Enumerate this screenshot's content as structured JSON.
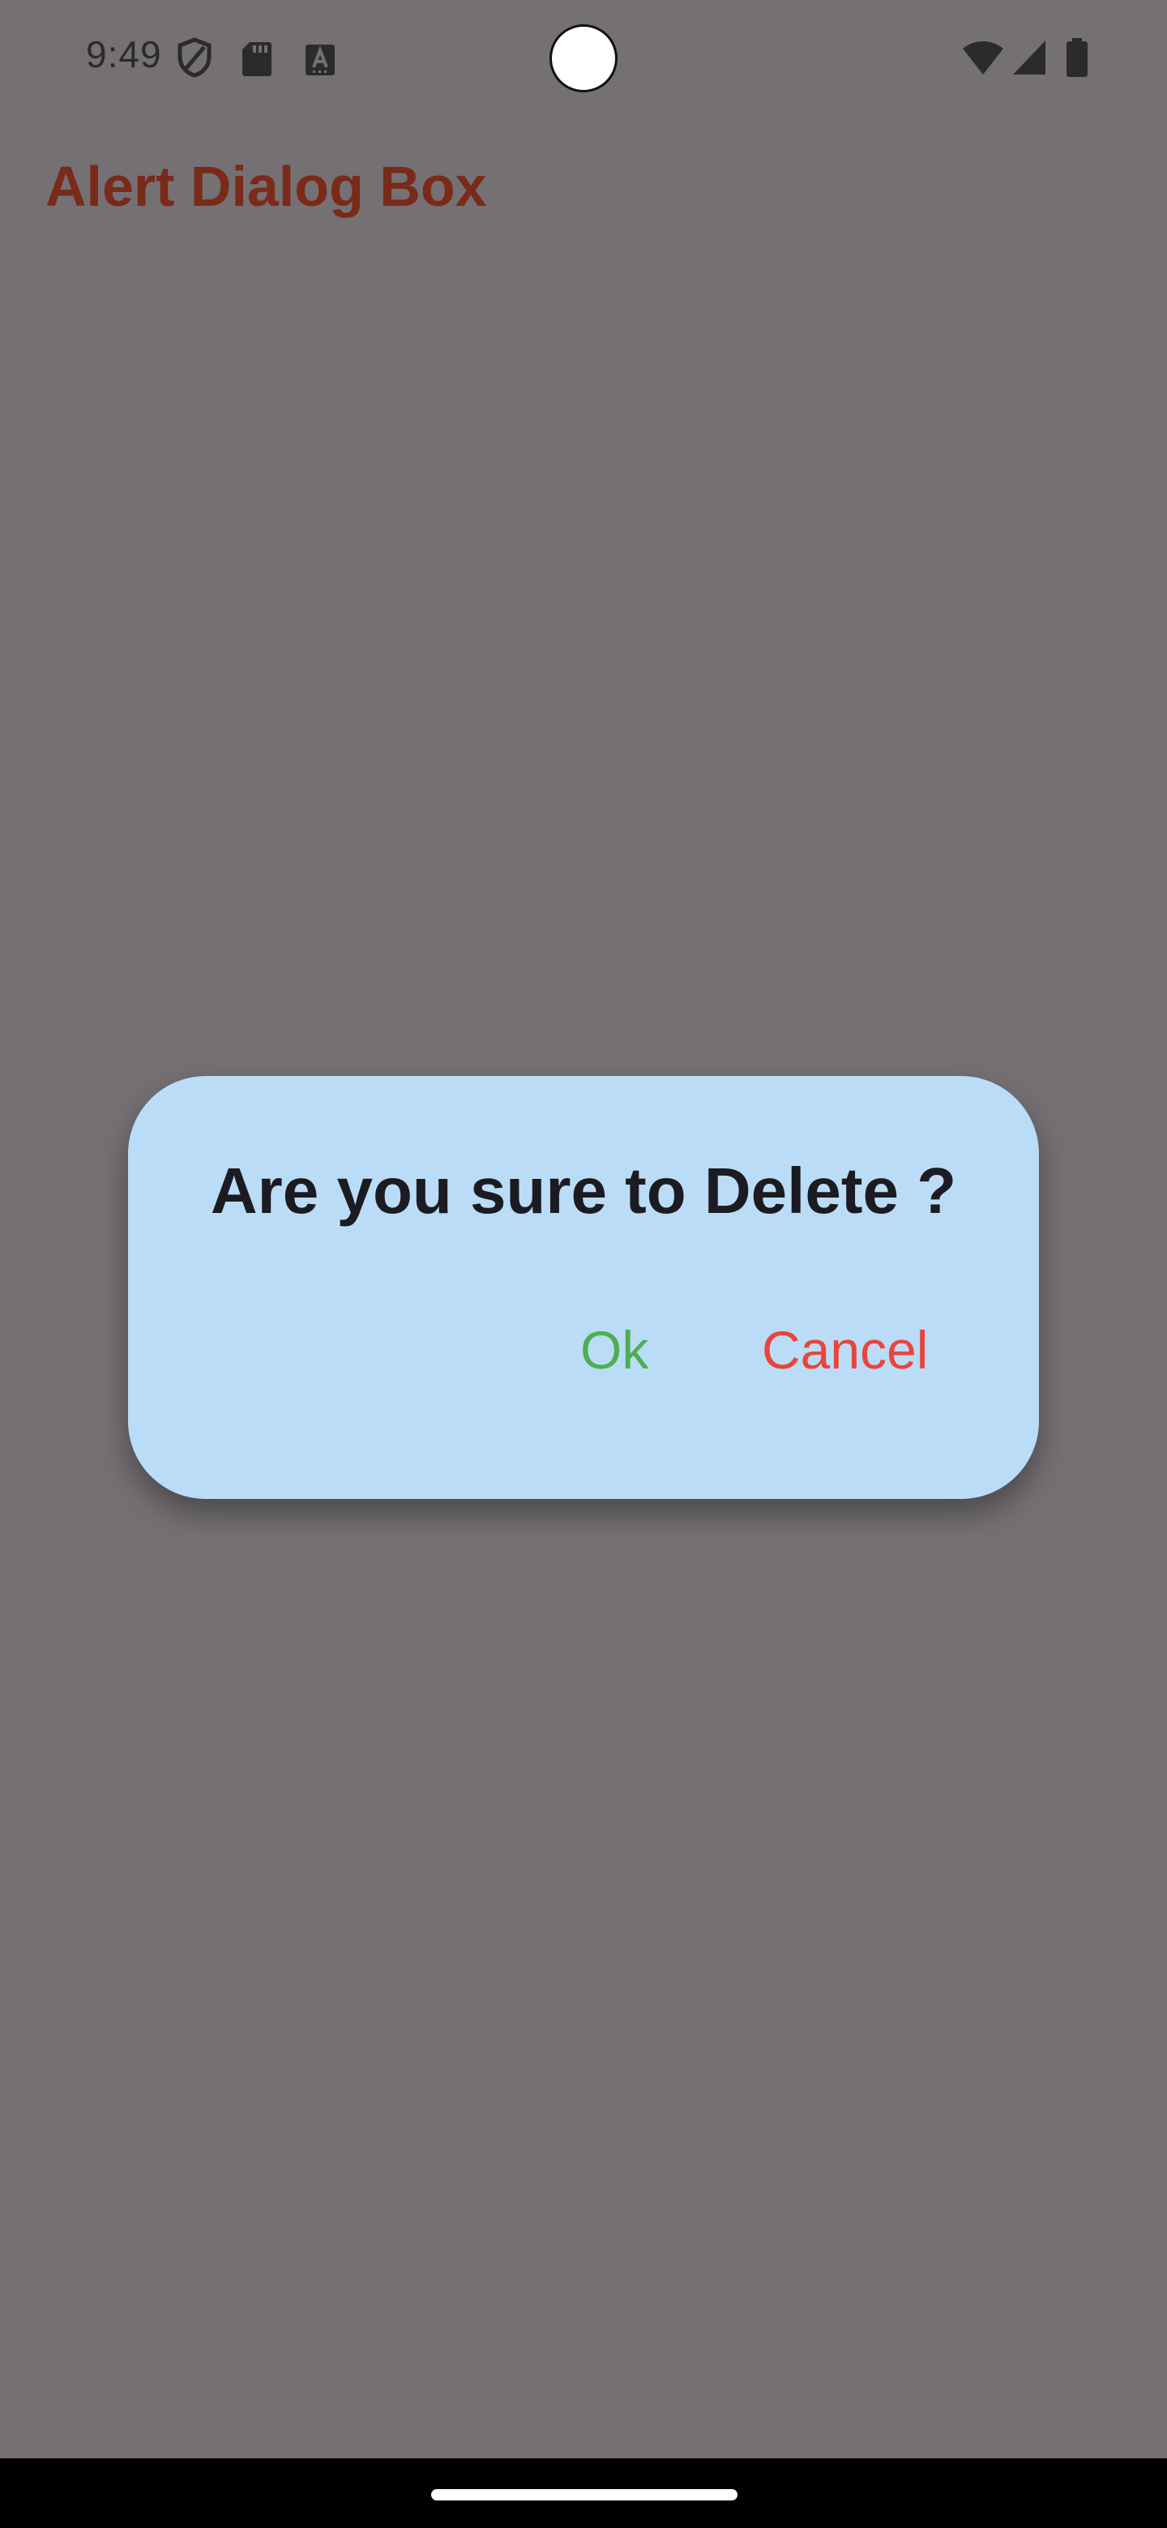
{
  "status_bar": {
    "time": "9:49",
    "left_icons": [
      "shield-icon",
      "sd-card-icon",
      "keyboard-a-icon"
    ],
    "right_icons": [
      "wifi-icon",
      "signal-icon",
      "battery-icon"
    ]
  },
  "app": {
    "title": "Alert Dialog Box"
  },
  "dialog": {
    "title": "Are you sure to Delete ?",
    "ok_label": "Ok",
    "cancel_label": "Cancel"
  },
  "colors": {
    "scrim": "#747074",
    "title_accent": "#7a2a18",
    "dialog_bg": "#bbdcf6",
    "ok": "#4caf50",
    "cancel": "#e8453c"
  }
}
